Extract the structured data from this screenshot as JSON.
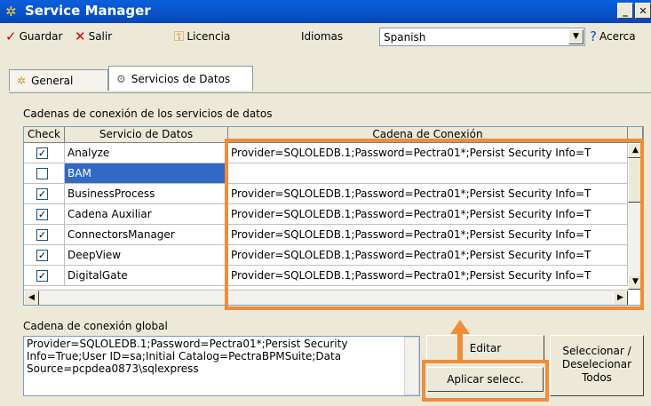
{
  "window": {
    "title": "Service Manager"
  },
  "toolbar": {
    "guardar": "Guardar",
    "salir": "Salir",
    "licencia": "Licencia",
    "idiomas_label": "Idiomas",
    "language_selected": "Spanish",
    "acerca": "Acerca"
  },
  "tabs": [
    {
      "label": "General"
    },
    {
      "label": "Servicios de Datos"
    }
  ],
  "grid": {
    "section_label": "Cadenas de conexión de los servicios de datos",
    "headers": {
      "check": "Check",
      "service": "Servicio de Datos",
      "connection": "Cadena de Conexión"
    },
    "rows": [
      {
        "checked": true,
        "service": "Analyze",
        "connection": "Provider=SQLOLEDB.1;Password=Pectra01*;Persist Security Info=T"
      },
      {
        "checked": false,
        "service": "BAM",
        "connection": ""
      },
      {
        "checked": true,
        "service": "BusinessProcess",
        "connection": "Provider=SQLOLEDB.1;Password=Pectra01*;Persist Security Info=T"
      },
      {
        "checked": true,
        "service": "Cadena Auxiliar",
        "connection": "Provider=SQLOLEDB.1;Password=Pectra01*;Persist Security Info=T"
      },
      {
        "checked": true,
        "service": "ConnectorsManager",
        "connection": "Provider=SQLOLEDB.1;Password=Pectra01*;Persist Security Info=T"
      },
      {
        "checked": true,
        "service": "DeepView",
        "connection": "Provider=SQLOLEDB.1;Password=Pectra01*;Persist Security Info=T"
      },
      {
        "checked": true,
        "service": "DigitalGate",
        "connection": "Provider=SQLOLEDB.1;Password=Pectra01*;Persist Security Info=T"
      }
    ],
    "selected_service": "BAM"
  },
  "global": {
    "label": "Cadena de conexión global",
    "value": "Provider=SQLOLEDB.1;Password=Pectra01*;Persist Security Info=True;User ID=sa;Initial Catalog=PectraBPMSuite;Data Source=pcpdea0873\\sqlexpress"
  },
  "buttons": {
    "editar": "Editar",
    "aplicar": "Aplicar selecc.",
    "seleccionar_1": "Seleccionar /",
    "seleccionar_2": "Deselecionar",
    "seleccionar_3": "Todos"
  },
  "colors": {
    "accent": "#f08c3a",
    "selection": "#316ac5",
    "titlebar": "#0a5fdc"
  },
  "icons": {
    "app": "gear-icon",
    "guardar": "checkmark-icon",
    "salir": "x-icon",
    "licencia": "key-icon",
    "acerca": "help-icon"
  }
}
